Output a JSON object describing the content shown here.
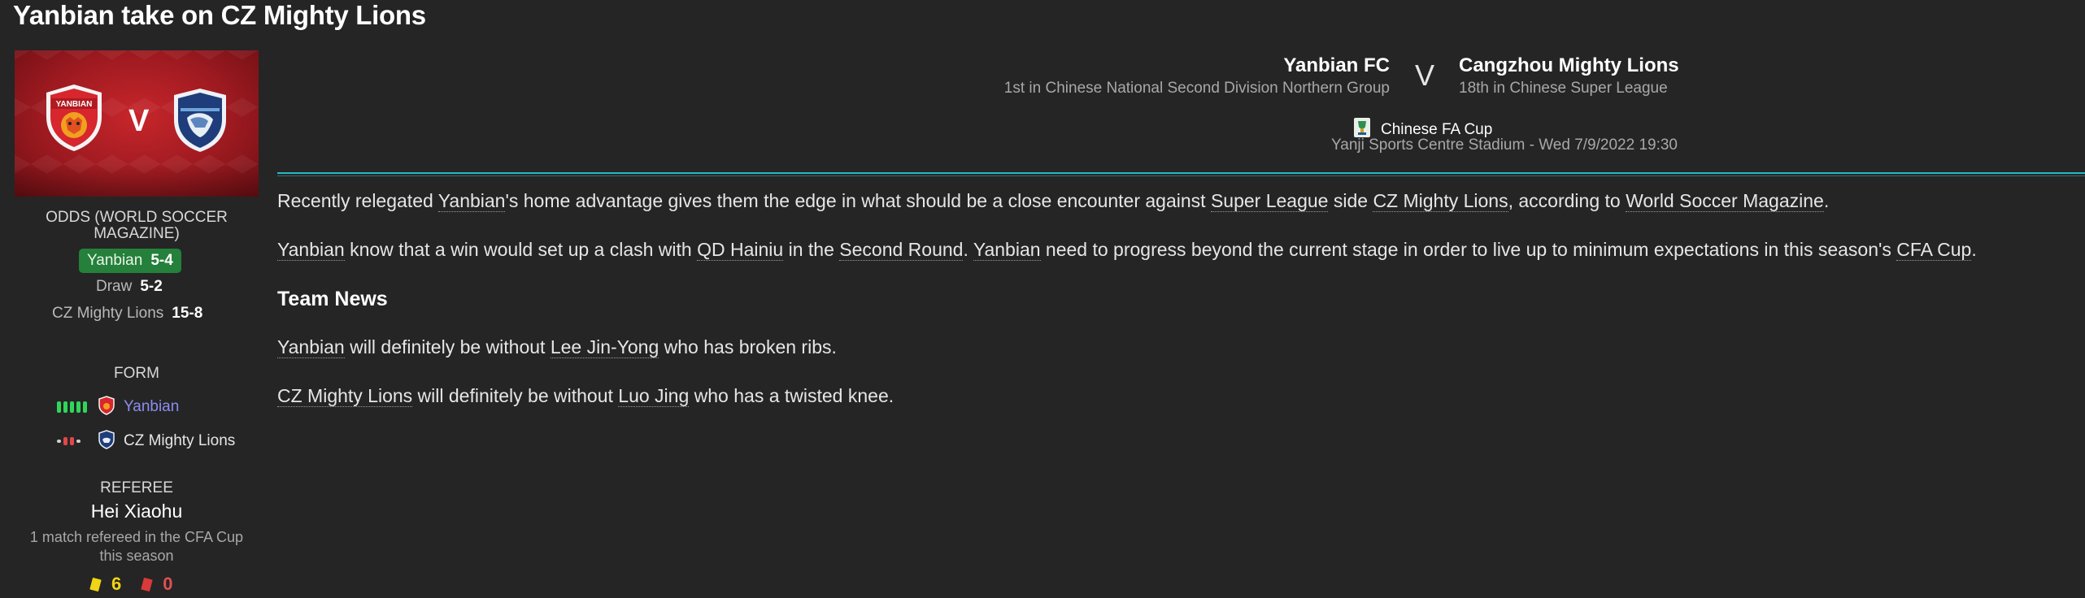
{
  "page": {
    "title": "Yanbian take on CZ Mighty Lions"
  },
  "banner": {
    "vs": "V",
    "home_crest_text": "YANBIAN",
    "home_crest_icon": "yanbian-tiger-crest-icon",
    "away_crest_icon": "cangzhou-lion-crest-icon"
  },
  "odds": {
    "heading": "ODDS (WORLD SOCCER MAGAZINE)",
    "home": {
      "label": "Yanbian",
      "value": "5-4"
    },
    "draw": {
      "label": "Draw",
      "value": "5-2"
    },
    "away": {
      "label": "CZ Mighty Lions",
      "value": "15-8"
    }
  },
  "form": {
    "heading": "FORM",
    "home": {
      "club": "Yanbian",
      "pips": [
        "W",
        "W",
        "W",
        "W",
        "W"
      ]
    },
    "away": {
      "club": "CZ Mighty Lions",
      "pips": [
        "D",
        "L",
        "L",
        "D"
      ]
    }
  },
  "referee": {
    "heading": "REFEREE",
    "name": "Hei Xiaohu",
    "note": "1 match refereed in the CFA Cup this season",
    "yellow": "6",
    "red": "0"
  },
  "fixture": {
    "home_name": "Yanbian FC",
    "home_position": "1st in Chinese National Second Division Northern Group",
    "vs": "V",
    "away_name": "Cangzhou Mighty Lions",
    "away_position": "18th in Chinese Super League",
    "competition": "Chinese FA Cup",
    "competition_icon": "cfa-cup-trophy-icon",
    "venue": "Yanji Sports Centre Stadium - Wed 7/9/2022 19:30"
  },
  "article": {
    "p1": {
      "t1": "Recently relegated ",
      "l1": "Yanbian",
      "t2": "'s home advantage gives them the edge in what should be a close encounter against ",
      "l2": "Super League",
      "t3": " side ",
      "l3": "CZ Mighty Lions",
      "t4": ", according to ",
      "l4": "World Soccer Magazine",
      "t5": "."
    },
    "p2": {
      "l1": "Yanbian",
      "t1": " know that a win would set up a clash with ",
      "l2": "QD Hainiu",
      "t2": " in the ",
      "l3": "Second Round",
      "t3": ". ",
      "l4": "Yanbian",
      "t4": " need to progress beyond the current stage in order to live up to minimum expectations in this season's ",
      "l5": "CFA Cup",
      "t5": "."
    },
    "news_heading": "Team News",
    "p3": {
      "l1": "Yanbian",
      "t1": " will definitely be without ",
      "l2": "Lee Jin-Yong",
      "t2": " who has broken ribs."
    },
    "p4": {
      "l1": "CZ Mighty Lions",
      "t1": " will definitely be without ",
      "l2": "Luo Jing",
      "t2": " who has a twisted knee."
    }
  },
  "colors": {
    "background": "#252525",
    "accent_rule": "#29b8c4",
    "home_odds_bg": "#24803a",
    "form_win": "#2fd65a",
    "form_loss": "#e04848",
    "form_draw": "#cfcfcf"
  }
}
